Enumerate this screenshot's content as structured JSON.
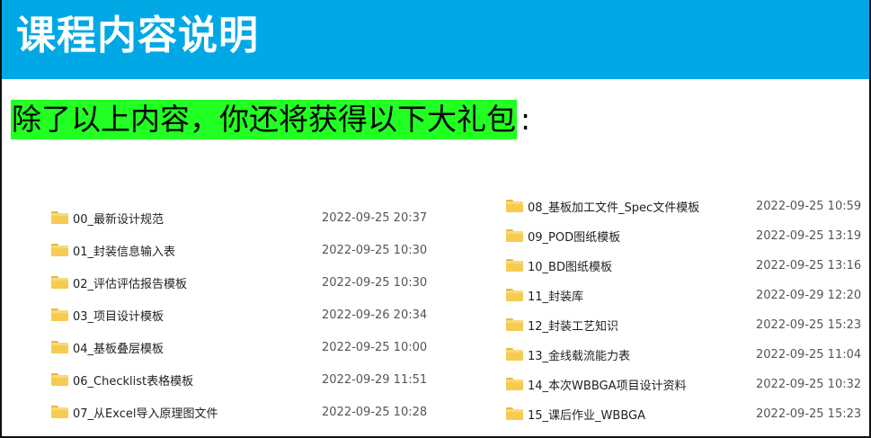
{
  "header": {
    "title": "课程内容说明"
  },
  "bonus": {
    "highlighted": "除了以上内容，你还将获得以下大礼包",
    "colon": ":"
  },
  "colors": {
    "header_bg": "#00a8e6",
    "highlight": "#22ff22",
    "folder": "#f6cb52"
  },
  "left_folders": [
    {
      "name": "00_最新设计规范",
      "date": "2022-09-25 20:37"
    },
    {
      "name": "01_封装信息输入表",
      "date": "2022-09-25 10:30"
    },
    {
      "name": "02_评估评估报告模板",
      "date": "2022-09-25 10:30"
    },
    {
      "name": "03_项目设计模板",
      "date": "2022-09-26 20:34"
    },
    {
      "name": "04_基板叠层模板",
      "date": "2022-09-25 10:00"
    },
    {
      "name": "06_Checklist表格模板",
      "date": "2022-09-29 11:51"
    },
    {
      "name": "07_从Excel导入原理图文件",
      "date": "2022-09-25 10:28"
    }
  ],
  "right_folders": [
    {
      "name": "08_基板加工文件_Spec文件模板",
      "date": "2022-09-25 10:59"
    },
    {
      "name": "09_POD图纸模板",
      "date": "2022-09-25 13:19"
    },
    {
      "name": "10_BD图纸模板",
      "date": "2022-09-25 13:16"
    },
    {
      "name": "11_封装库",
      "date": "2022-09-29 12:20"
    },
    {
      "name": "12_封装工艺知识",
      "date": "2022-09-25 15:23"
    },
    {
      "name": "13_金线载流能力表",
      "date": "2022-09-25 11:04"
    },
    {
      "name": "14_本次WBBGA项目设计资料",
      "date": "2022-09-25 10:32"
    },
    {
      "name": "15_课后作业_WBBGA",
      "date": "2022-09-25 15:23"
    }
  ]
}
